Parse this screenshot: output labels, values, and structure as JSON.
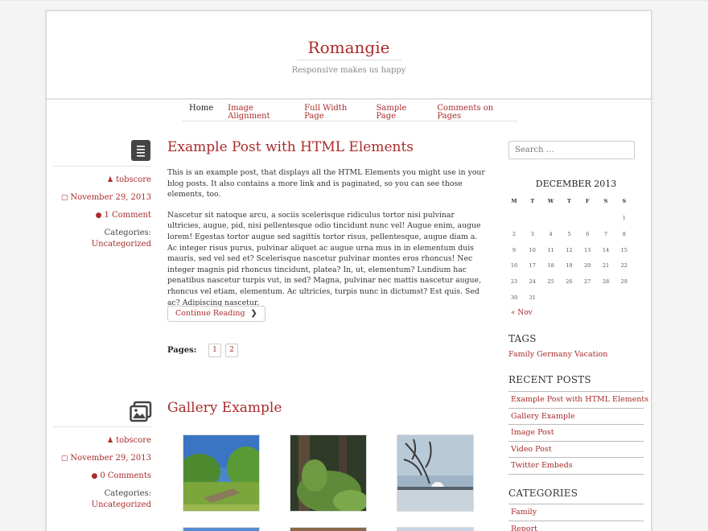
{
  "site": {
    "title": "Romangie",
    "tagline": "Responsive makes us happy"
  },
  "nav": [
    "Home",
    "Image Alignment",
    "Full Width Page",
    "Sample Page",
    "Comments on Pages"
  ],
  "posts": [
    {
      "title": "Example Post with HTML Elements",
      "format_icon": "document-icon",
      "author": "tobscore",
      "date": "November 29, 2013",
      "comments": "1 Comment",
      "categories_label": "Categories:",
      "category": "Uncategorized",
      "para1": "This is an example post, that displays all the HTML Elements you might use in your blog posts. It also contains a more link and is paginated, so you can see those elements, too.",
      "para2": "Nascetur sit natoque arcu, a sociis scelerisque ridiculus tortor nisi pulvinar ultricies, augue, pid, nisi pellentesque odio tincidunt nunc vel! Augue enim, augue lorem! Egestas tortor augue sed sagittis tortor risus, pellentesque, augue diam a. Ac integer risus purus, pulvinar aliquet ac augue urna mus in in elementum duis mauris, sed vel sed et? Scelerisque nascetur pulvinar montes eros rhoncus! Nec integer magnis pid rhoncus tincidunt, platea? In, ut, elementum? Lundium hac penatibus nascetur turpis vut, in sed? Magna, pulvinar nec mattis nascetur augue, rhoncus vel etiam, elementum. Ac ultricies, turpis nunc in dictumst? Est quis. Sed ac? Adipiscing nascetur.",
      "continue": "Continue Reading",
      "pages_label": "Pages:",
      "pages": [
        "1",
        "2"
      ]
    },
    {
      "title": "Gallery Example",
      "format_icon": "gallery-icon",
      "author": "tobscore",
      "date": "November 29, 2013",
      "comments": "0 Comments",
      "categories_label": "Categories:",
      "category": "Uncategorized"
    }
  ],
  "sidebar": {
    "search_placeholder": "Search …",
    "calendar": {
      "caption": "DECEMBER 2013",
      "weekdays": [
        "M",
        "T",
        "W",
        "T",
        "F",
        "S",
        "S"
      ],
      "weeks": [
        [
          "",
          "",
          "",
          "",
          "",
          "",
          "1"
        ],
        [
          "2",
          "3",
          "4",
          "5",
          "6",
          "7",
          "8"
        ],
        [
          "9",
          "10",
          "11",
          "12",
          "13",
          "14",
          "15"
        ],
        [
          "16",
          "17",
          "18",
          "19",
          "20",
          "21",
          "22"
        ],
        [
          "23",
          "24",
          "25",
          "26",
          "27",
          "28",
          "29"
        ],
        [
          "30",
          "31",
          "",
          "",
          "",
          "",
          ""
        ]
      ],
      "prev": "« Nov"
    },
    "tags_title": "TAGS",
    "tags": "Family Germany Vacation",
    "recent_title": "RECENT POSTS",
    "recent": [
      "Example Post with HTML Elements",
      "Gallery Example",
      "Image Post",
      "Video Post",
      "Twitter Embeds"
    ],
    "categories_title": "CATEGORIES",
    "categories": [
      "Family",
      "Report"
    ]
  },
  "colors": {
    "accent": "#a92b2b",
    "text": "#333333",
    "rule": "#e2e2e2"
  }
}
